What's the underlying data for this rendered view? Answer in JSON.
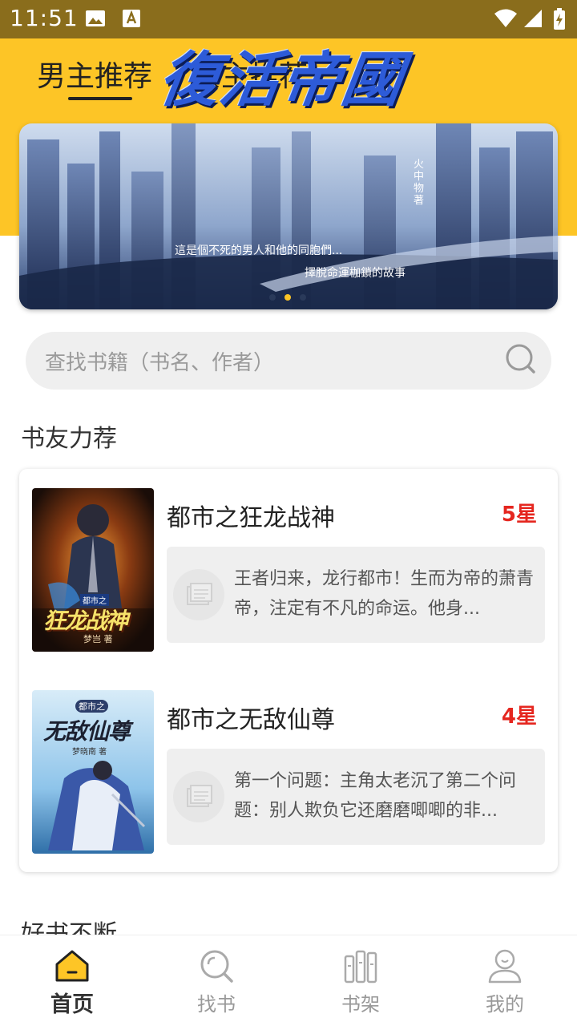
{
  "status_bar": {
    "time": "11:51"
  },
  "tabs": [
    {
      "label": "男主推荐",
      "active": true
    },
    {
      "label": "女主推荐",
      "active": false
    }
  ],
  "banner": {
    "title": "復活帝國",
    "author": "火中物 著",
    "tagline_1": "這是個不死的男人和他的同胞們...",
    "tagline_2": "擇脫命運枷鎖的故事",
    "active_slide": 2,
    "slide_count": 3
  },
  "search": {
    "placeholder": "查找书籍（书名、作者）"
  },
  "sections": {
    "recommend_title": "书友力荐",
    "more_title": "好书不断"
  },
  "books": [
    {
      "title": "都市之狂龙战神",
      "rating": "5星",
      "description": "王者归来，龙行都市！生而为帝的萧青帝，注定有不凡的命运。他身...",
      "cover_text": "狂龙战神",
      "cover_series": "都市之",
      "cover_author": "梦岂 著"
    },
    {
      "title": "都市之无敌仙尊",
      "rating": "4星",
      "description": "第一个问题：主角太老沉了第二个问题：别人欺负它还磨磨唧唧的非...",
      "cover_text": "无敌仙尊",
      "cover_series": "都市之",
      "cover_author": "梦晓南 著"
    }
  ],
  "bottom_nav": [
    {
      "label": "首页",
      "icon": "home-icon",
      "active": true
    },
    {
      "label": "找书",
      "icon": "search-icon",
      "active": false
    },
    {
      "label": "书架",
      "icon": "bookshelf-icon",
      "active": false
    },
    {
      "label": "我的",
      "icon": "profile-icon",
      "active": false
    }
  ],
  "colors": {
    "accent_yellow": "#fdc526",
    "status_bar": "#8a6d1c",
    "rating_red": "#e5261f"
  }
}
